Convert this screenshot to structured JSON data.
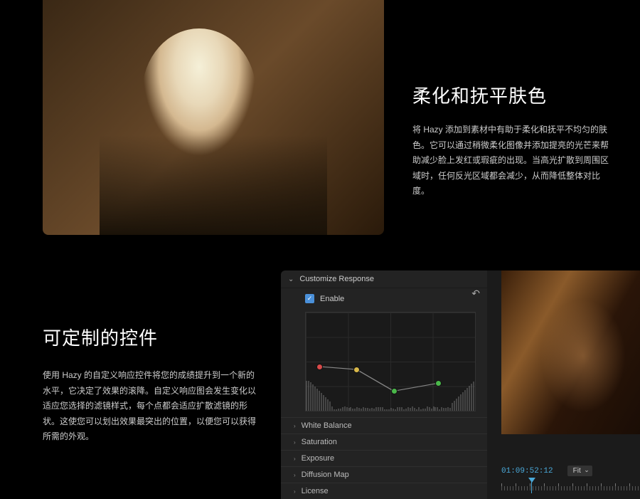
{
  "section1": {
    "title": "柔化和抚平肤色",
    "body": "将 Hazy 添加到素材中有助于柔化和抚平不均匀的肤色。它可以通过稍微柔化图像并添加提亮的光芒来帮助减少脸上发红或瑕疵的出现。当高光扩散到周围区域时，任何反光区域都会减少，从而降低整体对比度。"
  },
  "section2": {
    "title": "可定制的控件",
    "body": "使用 Hazy 的自定义响应控件将您的成绩提升到一个新的水平，它决定了效果的滚降。自定义响应图会发生变化以适应您选择的滤镜样式，每个点都会适应扩散滤镜的形状。这使您可以划出效果最突出的位置，以便您可以获得所需的外观。"
  },
  "panel": {
    "header": "Customize Response",
    "enable_label": "Enable",
    "params": [
      "White Balance",
      "Saturation",
      "Exposure",
      "Diffusion Map",
      "License"
    ],
    "curve": {
      "points": [
        {
          "x": 8,
          "y": 55,
          "color": "#d94a4a"
        },
        {
          "x": 30,
          "y": 58,
          "color": "#d9b84a"
        },
        {
          "x": 52,
          "y": 80,
          "color": "#4ab84a"
        },
        {
          "x": 78,
          "y": 72,
          "color": "#4ab84a"
        }
      ]
    }
  },
  "preview": {
    "timecode": "01:09:52:12",
    "fit_label": "Fit"
  }
}
